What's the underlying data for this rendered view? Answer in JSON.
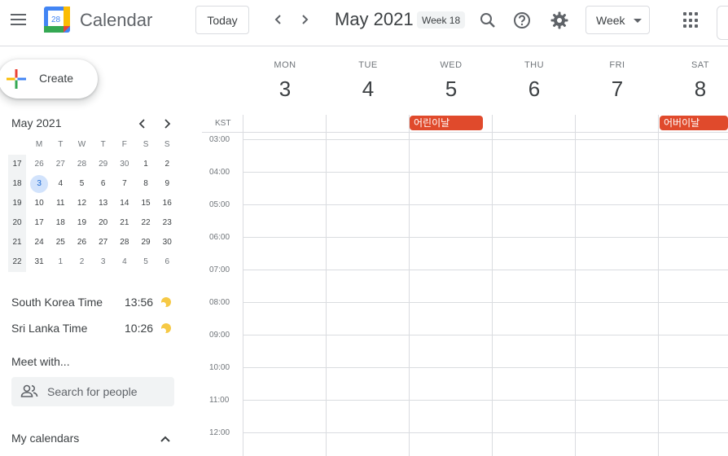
{
  "header": {
    "app_title": "Calendar",
    "logo_day": "28",
    "today_label": "Today",
    "date_title": "May 2021",
    "week_chip": "Week 18",
    "view_label": "Week"
  },
  "sidebar": {
    "create_label": "Create",
    "mini_calendar": {
      "title": "May 2021",
      "weekday_heads": [
        "M",
        "T",
        "W",
        "T",
        "F",
        "S",
        "S"
      ],
      "weeks": [
        {
          "wk": "17",
          "days": [
            "26",
            "27",
            "28",
            "29",
            "30",
            "1",
            "2"
          ]
        },
        {
          "wk": "18",
          "days": [
            "3",
            "4",
            "5",
            "6",
            "7",
            "8",
            "9"
          ]
        },
        {
          "wk": "19",
          "days": [
            "10",
            "11",
            "12",
            "13",
            "14",
            "15",
            "16"
          ]
        },
        {
          "wk": "20",
          "days": [
            "17",
            "18",
            "19",
            "20",
            "21",
            "22",
            "23"
          ]
        },
        {
          "wk": "21",
          "days": [
            "24",
            "25",
            "26",
            "27",
            "28",
            "29",
            "30"
          ]
        },
        {
          "wk": "22",
          "days": [
            "31",
            "1",
            "2",
            "3",
            "4",
            "5",
            "6"
          ]
        }
      ],
      "selected_day": "3"
    },
    "world_clock": [
      {
        "name": "South Korea Time",
        "time": "13:56"
      },
      {
        "name": "Sri Lanka Time",
        "time": "10:26"
      }
    ],
    "meet_title": "Meet with...",
    "people_placeholder": "Search for people",
    "my_calendars_title": "My calendars"
  },
  "week_view": {
    "timezone_label": "KST",
    "days": [
      {
        "name": "MON",
        "num": "3"
      },
      {
        "name": "TUE",
        "num": "4"
      },
      {
        "name": "WED",
        "num": "5"
      },
      {
        "name": "THU",
        "num": "6"
      },
      {
        "name": "FRI",
        "num": "7"
      },
      {
        "name": "SAT",
        "num": "8"
      }
    ],
    "hours": [
      "03:00",
      "04:00",
      "05:00",
      "06:00",
      "07:00",
      "08:00",
      "09:00",
      "10:00",
      "11:00",
      "12:00"
    ],
    "all_day_events": [
      {
        "title": "어린이날",
        "day": "WED"
      },
      {
        "title": "어버이날",
        "day": "SAT"
      }
    ]
  },
  "colors": {
    "event": "#e04a2c",
    "accent": "#1a73e8",
    "selected_day_bg": "#d2e3fc"
  }
}
